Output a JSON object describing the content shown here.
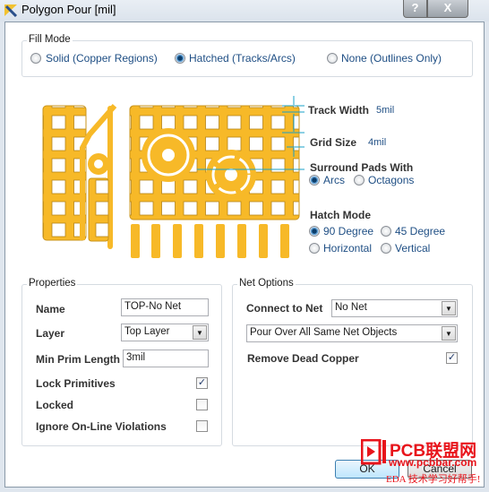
{
  "window": {
    "title": "Polygon Pour [mil]",
    "help": "?",
    "close": "X"
  },
  "fill_mode": {
    "label": "Fill Mode",
    "options": [
      {
        "label": "Solid (Copper Regions)",
        "selected": false
      },
      {
        "label": "Hatched (Tracks/Arcs)",
        "selected": true
      },
      {
        "label": "None (Outlines Only)",
        "selected": false
      }
    ]
  },
  "hatch": {
    "track_width_label": "Track Width",
    "track_width": "5mil",
    "grid_size_label": "Grid Size",
    "grid_size": "4mil",
    "surround_label": "Surround Pads With",
    "surround": [
      {
        "label": "Arcs",
        "selected": true
      },
      {
        "label": "Octagons",
        "selected": false
      }
    ],
    "hatch_mode_label": "Hatch Mode",
    "hatch_modes": [
      {
        "label": "90 Degree",
        "selected": true
      },
      {
        "label": "45 Degree",
        "selected": false
      },
      {
        "label": "Horizontal",
        "selected": false
      },
      {
        "label": "Vertical",
        "selected": false
      }
    ]
  },
  "properties": {
    "label": "Properties",
    "name_label": "Name",
    "name": "TOP-No Net",
    "layer_label": "Layer",
    "layer": "Top Layer",
    "min_prim_label": "Min Prim Length",
    "min_prim": "3mil",
    "lock_primitives_label": "Lock Primitives",
    "lock_primitives": true,
    "locked_label": "Locked",
    "locked": false,
    "ignore_label": "Ignore On-Line Violations",
    "ignore": false
  },
  "net_options": {
    "label": "Net Options",
    "connect_label": "Connect to Net",
    "connect": "No Net",
    "pour_over": "Pour Over All Same Net Objects",
    "remove_dead_label": "Remove Dead Copper",
    "remove_dead": true
  },
  "buttons": {
    "ok": "OK",
    "cancel": "Cancel"
  },
  "watermark": {
    "brand": "PCB联盟网",
    "url": "www.pcbbar.com",
    "slogan": "EDA 技术学习好帮手!"
  },
  "colors": {
    "copper": "#f7b928",
    "accent": "#1e4e84",
    "cyan": "#1aa0c8"
  }
}
